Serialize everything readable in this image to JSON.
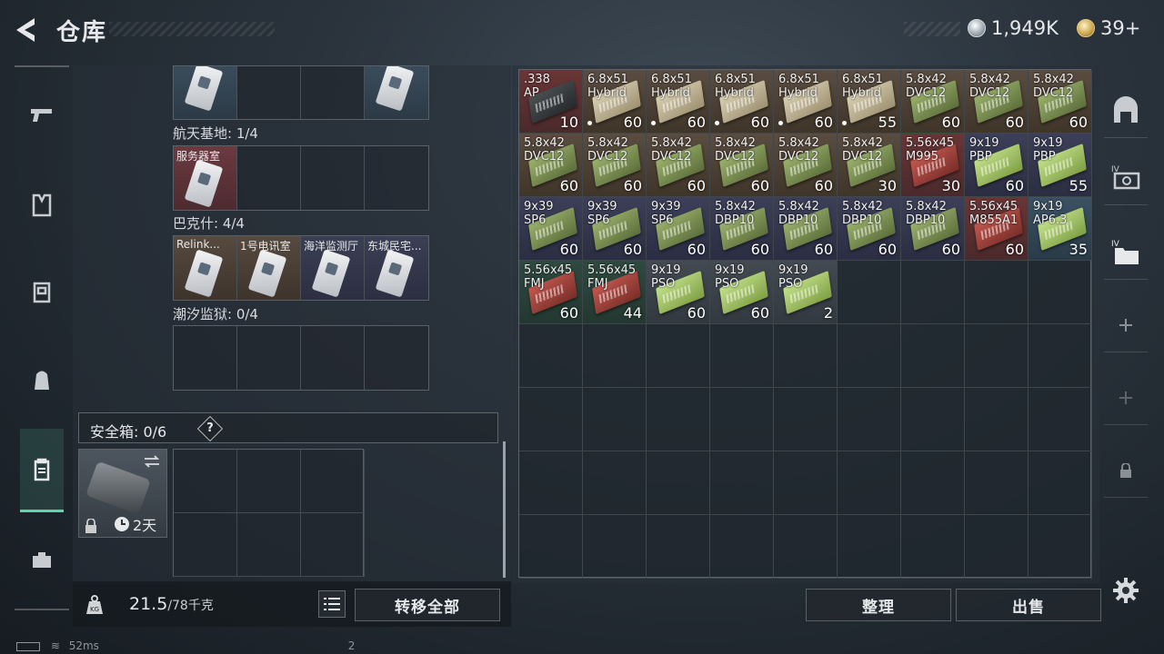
{
  "header": {
    "title": "仓库",
    "currencies": [
      {
        "icon": "silver-coin-icon",
        "value": "1,949K"
      },
      {
        "icon": "gold-coin-icon",
        "value": "39+"
      }
    ]
  },
  "left_tabs": [
    "pistol-icon",
    "vest-icon",
    "armor-icon",
    "backpack-icon",
    "case-icon",
    "toolbox-icon"
  ],
  "keycard_sections": [
    {
      "label": "航天基地: 1/4"
    },
    {
      "label": "巴克什: 4/4",
      "cards": [
        "Relink...",
        "1号电讯室",
        "海洋监测厅",
        "东城民宅..."
      ]
    },
    {
      "label": "潮汐监狱: 0/4"
    }
  ],
  "server_room_label": "服务器室",
  "safe_box": {
    "label": "安全箱: 0/6",
    "help": "?",
    "timer": "2天"
  },
  "weight": {
    "current": "21.5",
    "max": "/78千克"
  },
  "buttons": {
    "transfer_all": "转移全部",
    "sort": "整理",
    "sell": "出售"
  },
  "stash_items": [
    {
      "cal": ".338\nAP",
      "count": "10",
      "bg": "red",
      "box": "dark"
    },
    {
      "cal": "6.8x51\nHybrid",
      "count": "60",
      "bg": "brown",
      "box": "tan",
      "dot": true
    },
    {
      "cal": "6.8x51\nHybrid",
      "count": "60",
      "bg": "brown",
      "box": "tan",
      "dot": true
    },
    {
      "cal": "6.8x51\nHybrid",
      "count": "60",
      "bg": "brown",
      "box": "tan",
      "dot": true
    },
    {
      "cal": "6.8x51\nHybrid",
      "count": "60",
      "bg": "brown",
      "box": "tan",
      "dot": true
    },
    {
      "cal": "6.8x51\nHybrid",
      "count": "55",
      "bg": "brown",
      "box": "tan",
      "dot": true
    },
    {
      "cal": "5.8x42\nDVC12",
      "count": "60",
      "bg": "brown",
      "box": "olive"
    },
    {
      "cal": "5.8x42\nDVC12",
      "count": "60",
      "bg": "brown",
      "box": "olive"
    },
    {
      "cal": "5.8x42\nDVC12",
      "count": "60",
      "bg": "brown",
      "box": "olive"
    },
    {
      "cal": "5.8x42\nDVC12",
      "count": "60",
      "bg": "brown",
      "box": "olive"
    },
    {
      "cal": "5.8x42\nDVC12",
      "count": "60",
      "bg": "brown",
      "box": "olive"
    },
    {
      "cal": "5.8x42\nDVC12",
      "count": "60",
      "bg": "brown",
      "box": "olive"
    },
    {
      "cal": "5.8x42\nDVC12",
      "count": "60",
      "bg": "brown",
      "box": "olive"
    },
    {
      "cal": "5.8x42\nDVC12",
      "count": "60",
      "bg": "brown",
      "box": "olive"
    },
    {
      "cal": "5.8x42\nDVC12",
      "count": "30",
      "bg": "brown",
      "box": "olive"
    },
    {
      "cal": "5.56x45\nM995",
      "count": "30",
      "bg": "red",
      "box": "redbox"
    },
    {
      "cal": "9x19\nPBP",
      "count": "60",
      "bg": "navy",
      "box": "lime"
    },
    {
      "cal": "9x19\nPBP",
      "count": "55",
      "bg": "navy",
      "box": "lime"
    },
    {
      "cal": "9x39\nSP6",
      "count": "60",
      "bg": "navy",
      "box": "olive"
    },
    {
      "cal": "9x39\nSP6",
      "count": "60",
      "bg": "navy",
      "box": "olive"
    },
    {
      "cal": "9x39\nSP6",
      "count": "60",
      "bg": "navy",
      "box": "olive"
    },
    {
      "cal": "5.8x42\nDBP10",
      "count": "60",
      "bg": "navy",
      "box": "olive"
    },
    {
      "cal": "5.8x42\nDBP10",
      "count": "60",
      "bg": "navy",
      "box": "olive"
    },
    {
      "cal": "5.8x42\nDBP10",
      "count": "60",
      "bg": "navy",
      "box": "olive"
    },
    {
      "cal": "5.8x42\nDBP10",
      "count": "60",
      "bg": "navy",
      "box": "olive"
    },
    {
      "cal": "5.56x45\nM855A1",
      "count": "60",
      "bg": "red",
      "box": "redbox"
    },
    {
      "cal": "9x19\nAP6.3",
      "count": "35",
      "bg": "blue",
      "box": "lime"
    },
    {
      "cal": "5.56x45\nFMJ",
      "count": "60",
      "bg": "green",
      "box": "redbox"
    },
    {
      "cal": "5.56x45\nFMJ",
      "count": "44",
      "bg": "green",
      "box": "redbox"
    },
    {
      "cal": "9x19\nPSO",
      "count": "60",
      "bg": "gray",
      "box": "lime"
    },
    {
      "cal": "9x19\nPSO",
      "count": "60",
      "bg": "gray",
      "box": "lime"
    },
    {
      "cal": "9x19\nPSO",
      "count": "2",
      "bg": "gray",
      "box": "lime"
    }
  ],
  "status": {
    "ping": "52ms",
    "count": "2"
  }
}
